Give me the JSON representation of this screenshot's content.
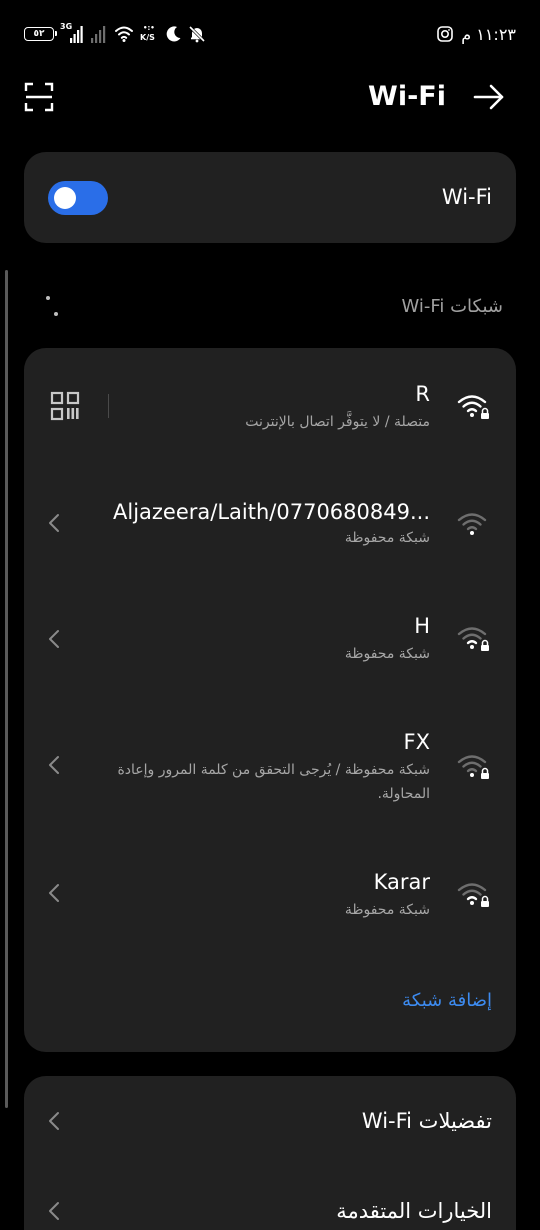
{
  "status_bar": {
    "battery": "٥٢",
    "network_type": "3G",
    "speed_dots": "•:•",
    "speed_unit": "K/S",
    "time": "١١:٢٣ م"
  },
  "header": {
    "title": "Wi-Fi"
  },
  "wifi_toggle": {
    "label": "Wi-Fi",
    "enabled": true,
    "color": "#2a6ee8"
  },
  "networks_section": {
    "title": "شبكات Wi-Fi"
  },
  "networks": [
    {
      "name": "R",
      "status": "متصلة / لا يتوفَّر اتصال بالإنترنت",
      "connected": true,
      "locked": true
    },
    {
      "name": "Aljazeera/Laith/0770680849...",
      "status": "شبكة محفوظة",
      "connected": false,
      "locked": false
    },
    {
      "name": "H",
      "status": "شبكة محفوظة",
      "connected": false,
      "locked": true
    },
    {
      "name": "FX",
      "status": "شبكة محفوظة / يُرجى التحقق من كلمة المرور وإعادة المحاولة.",
      "connected": false,
      "locked": true
    },
    {
      "name": "Karar",
      "status": "شبكة محفوظة",
      "connected": false,
      "locked": true
    }
  ],
  "add_network": "إضافة شبكة",
  "preferences": {
    "wifi_preferences": "تفضيلات Wi-Fi",
    "advanced_options": "الخيارات المتقدمة"
  },
  "colors": {
    "background": "#000000",
    "card": "#212121",
    "accent": "#3d8bf0",
    "secondary_text": "#a6a6a6"
  }
}
